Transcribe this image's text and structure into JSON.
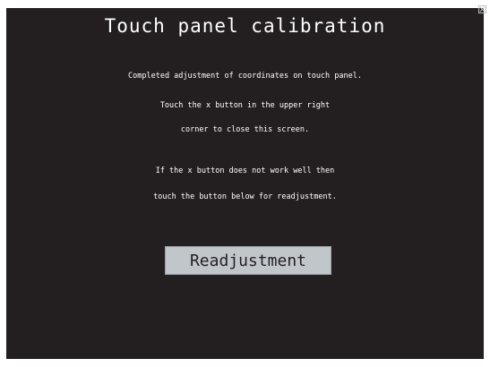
{
  "title": "Touch panel calibration",
  "messages": [
    "Completed adjustment of coordinates on touch panel.",
    "Touch the x button in the upper right",
    "corner to close this screen.",
    "If the x button does not work well then",
    "touch the button below for readjustment."
  ],
  "readjust_button": {
    "label": "Readjustment"
  },
  "close_button": {
    "icon": "close-icon"
  },
  "colors": {
    "background": "#231f20",
    "text": "#ffffff",
    "button": "#c1c6cb"
  }
}
